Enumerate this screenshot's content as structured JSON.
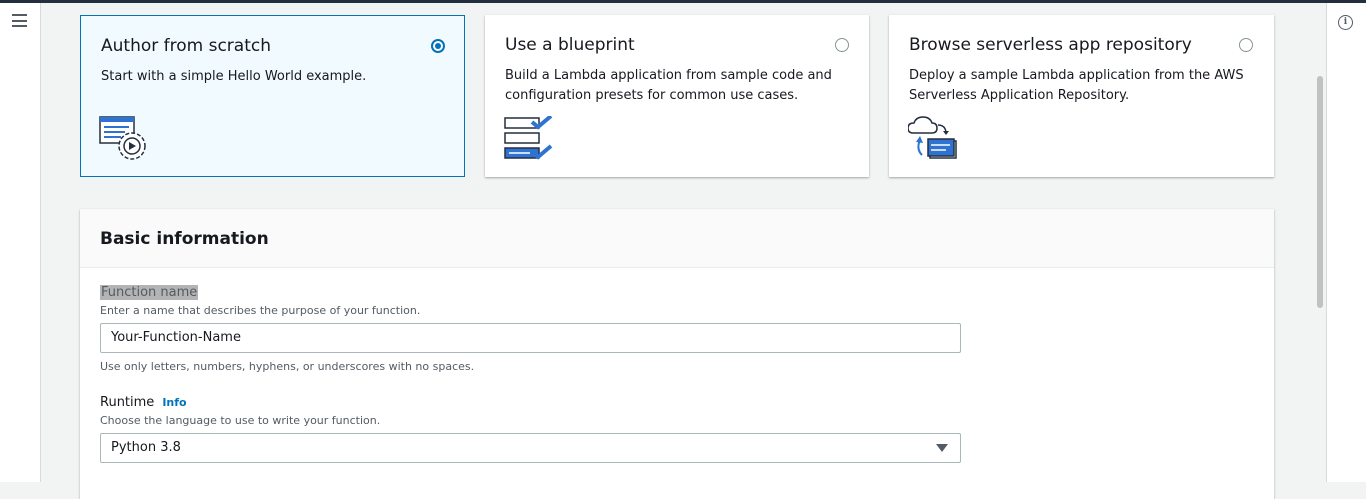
{
  "cards": [
    {
      "title": "Author from scratch",
      "desc": "Start with a simple Hello World example.",
      "selected": true
    },
    {
      "title": "Use a blueprint",
      "desc": "Build a Lambda application from sample code and configuration presets for common use cases.",
      "selected": false
    },
    {
      "title": "Browse serverless app repository",
      "desc": "Deploy a sample Lambda application from the AWS Serverless Application Repository.",
      "selected": false
    }
  ],
  "basic_info": {
    "title": "Basic information",
    "function_name": {
      "label": "Function name",
      "hint": "Enter a name that describes the purpose of your function.",
      "value": "Your-Function-Name",
      "constraint": "Use only letters, numbers, hyphens, or underscores with no spaces."
    },
    "runtime": {
      "label": "Runtime",
      "info": "Info",
      "hint": "Choose the language to use to write your function.",
      "value": "Python 3.8"
    }
  },
  "icons": {
    "nav": "hamburger-menu-icon",
    "help": "info-icon"
  },
  "colors": {
    "accent": "#0073bb",
    "selected_bg": "#f1faff",
    "topbar": "#232f3e"
  }
}
